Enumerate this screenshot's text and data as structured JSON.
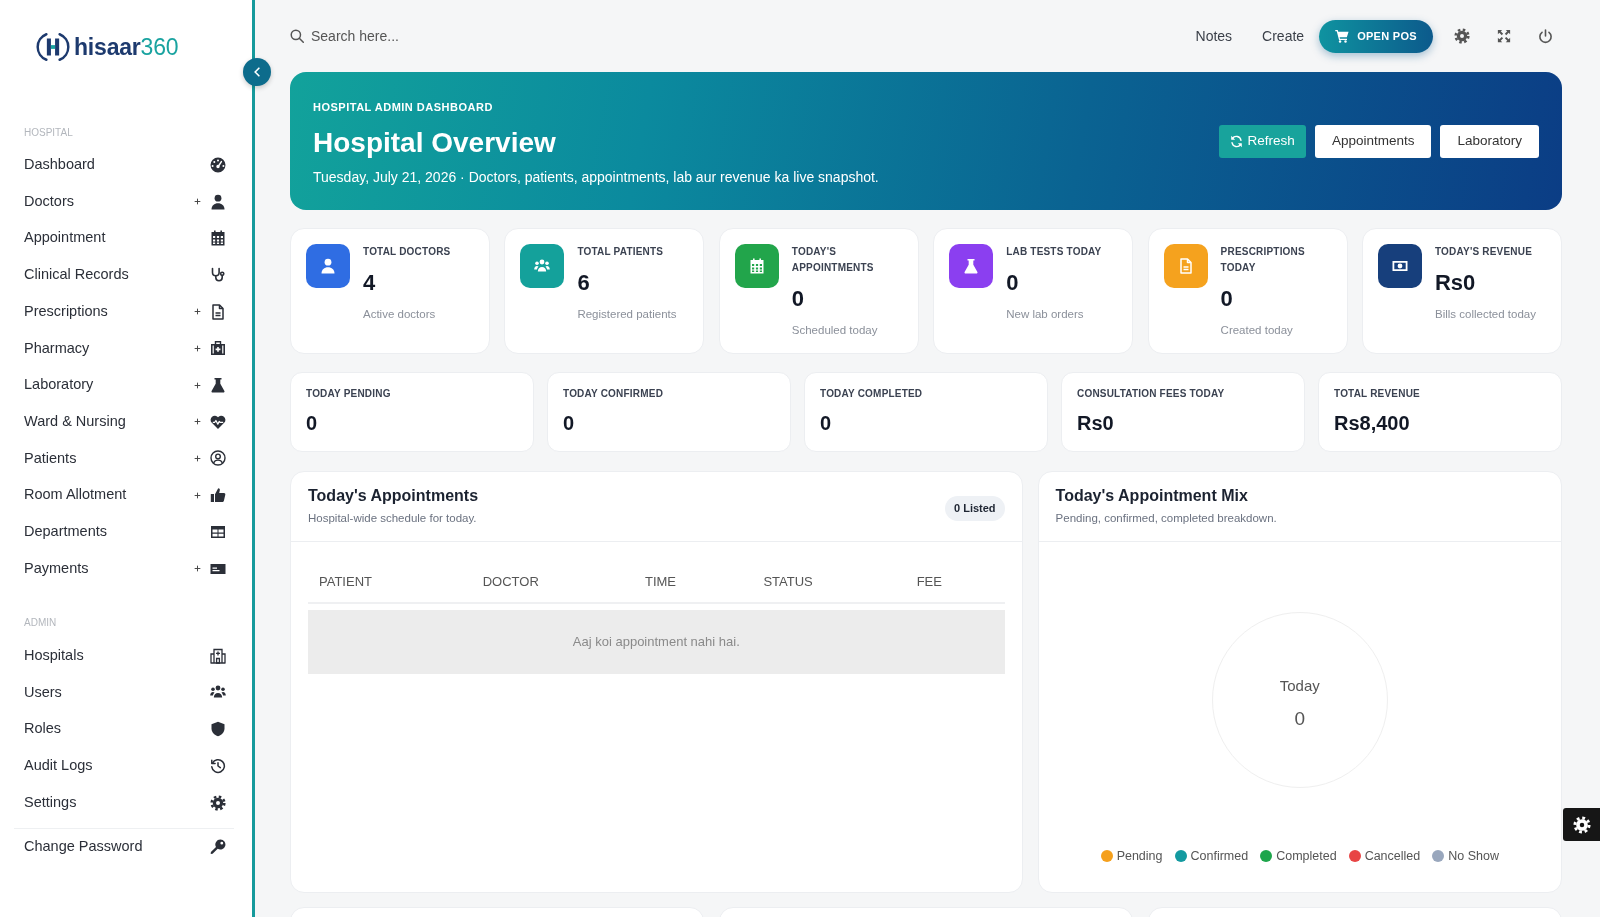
{
  "brand": {
    "name": "hisaar",
    "number": "360"
  },
  "sidebar": {
    "sections": [
      {
        "title": "HOSPITAL",
        "items": [
          {
            "label": "Dashboard",
            "submenu": false
          },
          {
            "label": "Doctors",
            "submenu": true
          },
          {
            "label": "Appointment",
            "submenu": false
          },
          {
            "label": "Clinical Records",
            "submenu": false
          },
          {
            "label": "Prescriptions",
            "submenu": true
          },
          {
            "label": "Pharmacy",
            "submenu": true
          },
          {
            "label": "Laboratory",
            "submenu": true
          },
          {
            "label": "Ward & Nursing",
            "submenu": true
          },
          {
            "label": "Patients",
            "submenu": true
          },
          {
            "label": "Room Allotment",
            "submenu": true
          },
          {
            "label": "Departments",
            "submenu": false
          },
          {
            "label": "Payments",
            "submenu": true
          }
        ]
      },
      {
        "title": "ADMIN",
        "items": [
          {
            "label": "Hospitals",
            "submenu": false
          },
          {
            "label": "Users",
            "submenu": false
          },
          {
            "label": "Roles",
            "submenu": false
          },
          {
            "label": "Audit Logs",
            "submenu": false
          },
          {
            "label": "Settings",
            "submenu": false
          }
        ]
      }
    ],
    "footer_items": [
      {
        "label": "Change Password",
        "submenu": false
      }
    ]
  },
  "topbar": {
    "search": {
      "placeholder": "Search here..."
    },
    "links": [
      "Notes",
      "Create"
    ],
    "pos_button": "OPEN POS"
  },
  "banner": {
    "eyebrow": "HOSPITAL ADMIN DASHBOARD",
    "title": "Hospital Overview",
    "subtitle": "Tuesday, July 21, 2026 · Doctors, patients, appointments, lab aur revenue ka live snapshot.",
    "buttons": [
      {
        "label": "Refresh",
        "kind": "accent"
      },
      {
        "label": "Appointments",
        "kind": "light"
      },
      {
        "label": "Laboratory",
        "kind": "light"
      }
    ]
  },
  "stat_cards": [
    {
      "label": "TOTAL DOCTORS",
      "value": "4",
      "note": "Active doctors",
      "color": "#2f6de3"
    },
    {
      "label": "TOTAL PATIENTS",
      "value": "6",
      "note": "Registered patients",
      "color": "#14a19b"
    },
    {
      "label": "TODAY'S APPOINTMENTS",
      "value": "0",
      "note": "Scheduled today",
      "color": "#22a54b"
    },
    {
      "label": "LAB TESTS TODAY",
      "value": "0",
      "note": "New lab orders",
      "color": "#8b3ff0"
    },
    {
      "label": "PRESCRIPTIONS TODAY",
      "value": "0",
      "note": "Created today",
      "color": "#f5a21e"
    },
    {
      "label": "TODAY'S REVENUE",
      "value": "Rs0",
      "note": "Bills collected today",
      "color": "#173f7c"
    }
  ],
  "summary_cards": [
    {
      "label": "TODAY PENDING",
      "value": "0"
    },
    {
      "label": "TODAY CONFIRMED",
      "value": "0"
    },
    {
      "label": "TODAY COMPLETED",
      "value": "0"
    },
    {
      "label": "CONSULTATION FEES TODAY",
      "value": "Rs0"
    },
    {
      "label": "TOTAL REVENUE",
      "value": "Rs8,400"
    }
  ],
  "appointments": {
    "title": "Today's Appointments",
    "subtitle": "Hospital-wide schedule for today.",
    "badge": "0 Listed",
    "columns": [
      "PATIENT",
      "DOCTOR",
      "TIME",
      "STATUS",
      "FEE"
    ],
    "empty_message": "Aaj koi appointment nahi hai."
  },
  "appointment_mix": {
    "title": "Today's Appointment Mix",
    "subtitle": "Pending, confirmed, completed breakdown.",
    "center_label": "Today",
    "center_value": "0",
    "legend": [
      {
        "label": "Pending",
        "color": "#f5a01c"
      },
      {
        "label": "Confirmed",
        "color": "#139aa0"
      },
      {
        "label": "Completed",
        "color": "#1ea54b"
      },
      {
        "label": "Cancelled",
        "color": "#e84545"
      },
      {
        "label": "No Show",
        "color": "#99a7bd"
      }
    ]
  }
}
